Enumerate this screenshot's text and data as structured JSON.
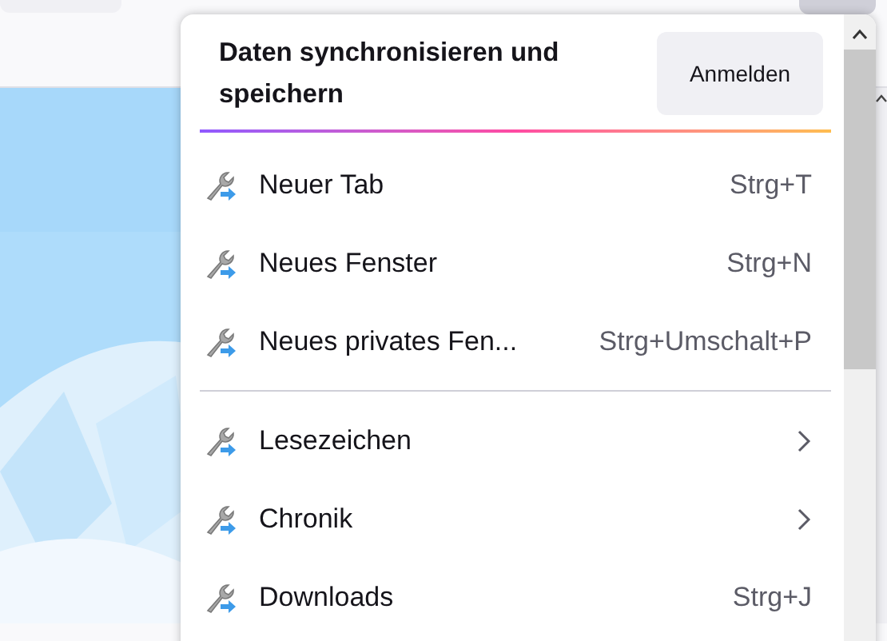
{
  "sync_panel": {
    "title": "Daten synchronisieren und speichern",
    "button": "Anmelden"
  },
  "menu_sections": [
    {
      "items": [
        {
          "kind": "shortcut",
          "label": "Neuer Tab",
          "shortcut": "Strg+T"
        },
        {
          "kind": "shortcut",
          "label": "Neues Fenster",
          "shortcut": "Strg+N"
        },
        {
          "kind": "shortcut",
          "label": "Neues privates Fen...",
          "shortcut": "Strg+Umschalt+P"
        }
      ]
    },
    {
      "items": [
        {
          "kind": "submenu",
          "label": "Lesezeichen"
        },
        {
          "kind": "submenu",
          "label": "Chronik"
        },
        {
          "kind": "shortcut",
          "label": "Downloads",
          "shortcut": "Strg+J"
        }
      ]
    }
  ]
}
